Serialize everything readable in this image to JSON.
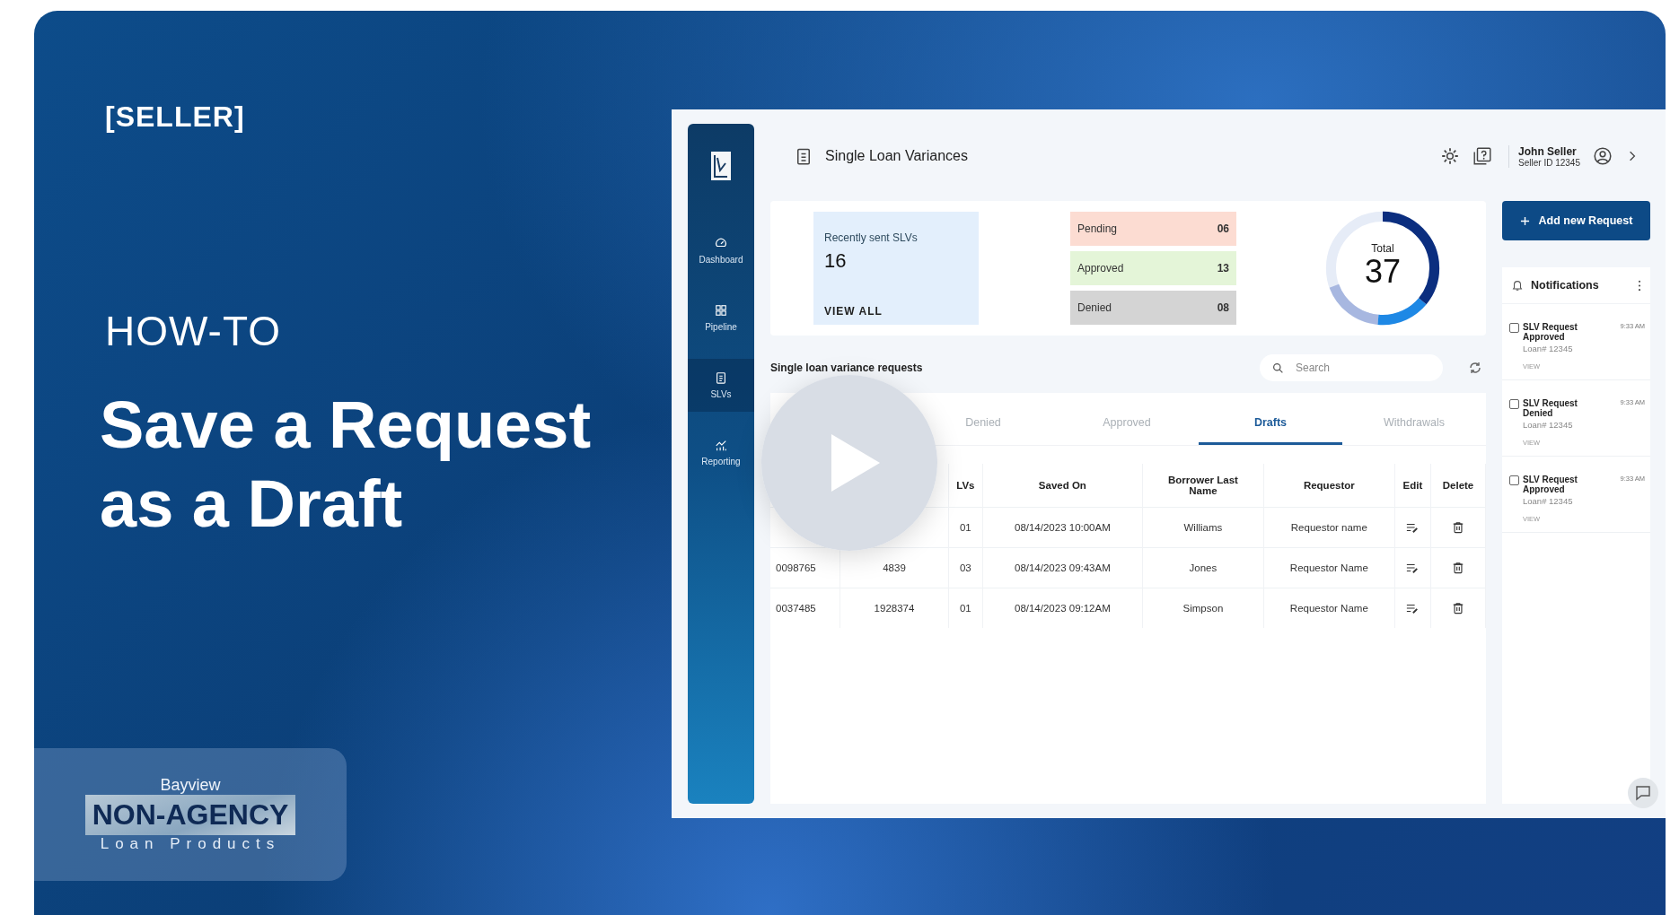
{
  "badge": "[SELLER]",
  "kicker": "HOW-TO",
  "title": "Save a Request as a Draft",
  "logo": {
    "top": "Bayview",
    "main": "NON-AGENCY",
    "sub": "Loan Products"
  },
  "app": {
    "sidebar": [
      {
        "label": "Dashboard",
        "selected": false
      },
      {
        "label": "Pipeline",
        "selected": false
      },
      {
        "label": "SLVs",
        "selected": true
      },
      {
        "label": "Reporting",
        "selected": false
      }
    ],
    "header": {
      "title": "Single Loan Variances",
      "user_name": "John Seller",
      "user_id": "Seller ID 12345"
    },
    "recent": {
      "label": "Recently sent SLVs",
      "count": "16",
      "link": "VIEW ALL"
    },
    "statuses": [
      {
        "label": "Pending",
        "count": "06",
        "color": "#fcdcd2"
      },
      {
        "label": "Approved",
        "count": "13",
        "color": "#e4f5d8"
      },
      {
        "label": "Denied",
        "count": "08",
        "color": "#d4d4d4"
      }
    ],
    "total": {
      "label": "Total",
      "count": "37"
    },
    "add_button": "Add new Request",
    "notifications": {
      "title": "Notifications",
      "items": [
        {
          "title": "SLV Request Approved",
          "time": "9:33 AM",
          "loan": "Loan# 12345",
          "link": "VIEW",
          "checked": false
        },
        {
          "title": "SLV Request Denied",
          "time": "9:33 AM",
          "loan": "Loan# 12345",
          "link": "VIEW",
          "checked": false
        },
        {
          "title": "SLV Request Approved",
          "time": "9:33 AM",
          "loan": "Loan# 12345",
          "link": "VIEW",
          "checked": false
        }
      ]
    },
    "requests": {
      "title": "Single loan variance requests",
      "search": {
        "placeholder": "Search"
      },
      "tabs": [
        {
          "label": "Denied",
          "selected": false
        },
        {
          "label": "Approved",
          "selected": false
        },
        {
          "label": "Drafts",
          "selected": true
        },
        {
          "label": "Withdrawals",
          "selected": false
        }
      ],
      "columns": [
        "LVs",
        "Saved On",
        "Borrower Last Name",
        "Requestor",
        "Edit",
        "Delete"
      ],
      "rows": [
        {
          "slvs": "01",
          "saved_on": "08/14/2023 10:00AM",
          "borrower": "Williams",
          "requestor": "Requestor name"
        },
        {
          "column_1": "0098765",
          "column_2": "4839",
          "slvs": "03",
          "saved_on": "08/14/2023 09:43AM",
          "borrower": "Jones",
          "requestor": "Requestor Name"
        },
        {
          "column_1": "0037485",
          "column_2": "1928374",
          "slvs": "01",
          "saved_on": "08/14/2023 09:12AM",
          "borrower": "Simpson",
          "requestor": "Requestor Name"
        }
      ]
    }
  }
}
